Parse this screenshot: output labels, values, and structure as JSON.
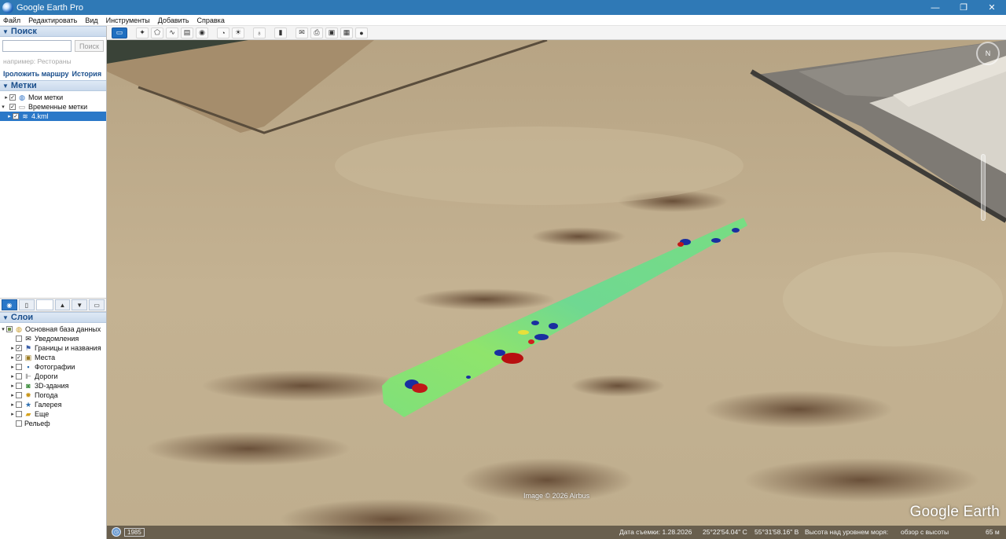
{
  "window": {
    "title": "Google Earth Pro",
    "minimize": "—",
    "maximize": "❐",
    "close": "✕"
  },
  "menu": [
    "Файл",
    "Редактировать",
    "Вид",
    "Инструменты",
    "Добавить",
    "Справка"
  ],
  "search": {
    "header": "Поиск",
    "placeholder": "",
    "button": "Поиск",
    "hint": "например: Рестораны",
    "links": [
      "Проложить маршрут",
      "История"
    ],
    "links_display": "Iроложить маршру"
  },
  "places": {
    "header": "Метки",
    "items": [
      {
        "label": "Мои метки",
        "checked": true
      },
      {
        "label": "Временные метки",
        "checked": true
      },
      {
        "label": "4.kml",
        "checked": true,
        "selected": true
      }
    ]
  },
  "layers": {
    "header": "Слои",
    "items": [
      {
        "label": "Основная база данных",
        "checked": "partial",
        "icon": "globe-icon"
      },
      {
        "label": "Уведомления",
        "checked": false,
        "icon": "envelope-icon"
      },
      {
        "label": "Границы и названия",
        "checked": true,
        "icon": "flag-icon"
      },
      {
        "label": "Места",
        "checked": true,
        "icon": "place-icon"
      },
      {
        "label": "Фотографии",
        "checked": false,
        "icon": "camera-icon"
      },
      {
        "label": "Дороги",
        "checked": false,
        "icon": "road-icon"
      },
      {
        "label": "3D-здания",
        "checked": false,
        "icon": "building-icon"
      },
      {
        "label": "Погода",
        "checked": false,
        "icon": "weather-icon"
      },
      {
        "label": "Галерея",
        "checked": false,
        "icon": "star-icon"
      },
      {
        "label": "Еще",
        "checked": false,
        "icon": "folder-icon"
      },
      {
        "label": "Рельеф",
        "checked": false,
        "icon": ""
      }
    ]
  },
  "map": {
    "copyright": "Image © 2026 Airbus",
    "logo": "Google Earth",
    "historic_year": "1985",
    "imagery_date": "Дата съемки: 1.28.2026",
    "lat": "25°22'54.04\" С",
    "lon": "55°31'58.16\" В",
    "elevation_label": "Высота над уровнем моря:",
    "eye_alt_label": "обзор с высоты",
    "eye_alt_value": "65 м",
    "compass_label": "N"
  },
  "colors": {
    "accent": "#2a78c8",
    "titlebar": "#2f79b6",
    "panel_header": "#1b4f8c"
  }
}
